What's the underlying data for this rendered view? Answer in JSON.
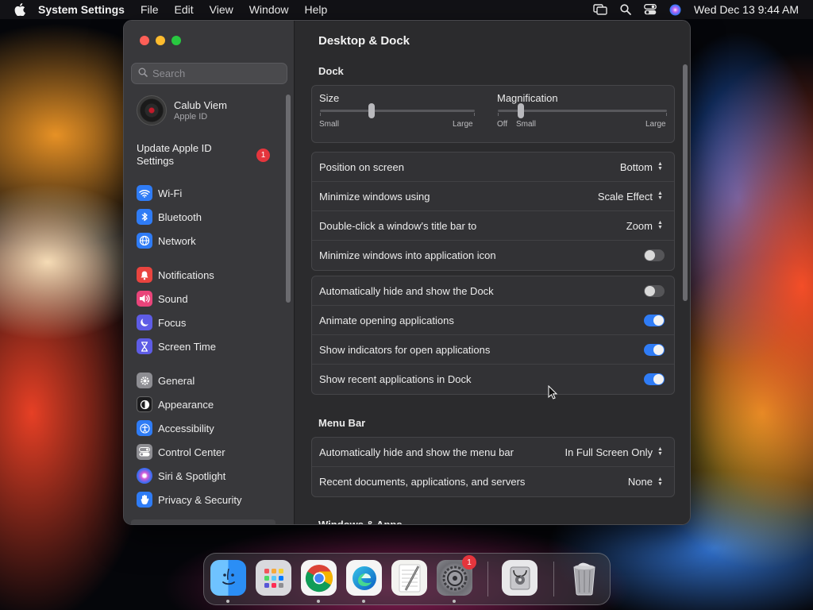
{
  "menubar": {
    "app_name": "System Settings",
    "menus": [
      "File",
      "Edit",
      "View",
      "Window",
      "Help"
    ],
    "clock": "Wed Dec 13  9:44 AM"
  },
  "sidebar": {
    "search_placeholder": "Search",
    "account": {
      "name": "Calub Viem",
      "subtitle": "Apple ID"
    },
    "update": {
      "label": "Update Apple ID Settings",
      "badge": "1"
    },
    "groups": [
      [
        {
          "label": "Wi-Fi",
          "icon": "wifi-icon",
          "color": "#2f7cf6"
        },
        {
          "label": "Bluetooth",
          "icon": "bluetooth-icon",
          "color": "#2f7cf6"
        },
        {
          "label": "Network",
          "icon": "globe-icon",
          "color": "#2f7cf6"
        }
      ],
      [
        {
          "label": "Notifications",
          "icon": "bell-icon",
          "color": "#e9443f"
        },
        {
          "label": "Sound",
          "icon": "speaker-icon",
          "color": "#e9447a"
        },
        {
          "label": "Focus",
          "icon": "moon-icon",
          "color": "#5e5ce6"
        },
        {
          "label": "Screen Time",
          "icon": "hourglass-icon",
          "color": "#5e5ce6"
        }
      ],
      [
        {
          "label": "General",
          "icon": "gear-icon",
          "color": "#8e8e93"
        },
        {
          "label": "Appearance",
          "icon": "appearance-icon",
          "color": "#1c1c1e"
        },
        {
          "label": "Accessibility",
          "icon": "accessibility-icon",
          "color": "#2f7cf6"
        },
        {
          "label": "Control Center",
          "icon": "control-center-icon",
          "color": "#8e8e93"
        },
        {
          "label": "Siri & Spotlight",
          "icon": "siri-icon",
          "color": "#b04bd8"
        },
        {
          "label": "Privacy & Security",
          "icon": "hand-icon",
          "color": "#2f7cf6"
        }
      ]
    ]
  },
  "main": {
    "title": "Desktop & Dock",
    "dock_section": "Dock",
    "size_slider": {
      "label": "Size",
      "min_label": "Small",
      "max_label": "Large",
      "value": 0.33
    },
    "magnification_slider": {
      "label": "Magnification",
      "off_label": "Off",
      "min_label": "Small",
      "max_label": "Large",
      "value": 0.14
    },
    "dock_settings": [
      {
        "label": "Position on screen",
        "value": "Bottom"
      },
      {
        "label": "Minimize windows using",
        "value": "Scale Effect"
      },
      {
        "label": "Double-click a window's title bar to",
        "value": "Zoom"
      },
      {
        "label": "Minimize windows into application icon",
        "toggle": false
      }
    ],
    "dock_toggles": [
      {
        "label": "Automatically hide and show the Dock",
        "toggle": false
      },
      {
        "label": "Animate opening applications",
        "toggle": true
      },
      {
        "label": "Show indicators for open applications",
        "toggle": true
      },
      {
        "label": "Show recent applications in Dock",
        "toggle": true
      }
    ],
    "menubar_section": "Menu Bar",
    "menubar_settings": [
      {
        "label": "Automatically hide and show the menu bar",
        "value": "In Full Screen Only"
      },
      {
        "label": "Recent documents, applications, and servers",
        "value": "None"
      }
    ],
    "next_section": "Windows & Apps"
  },
  "dock": {
    "apps": [
      "finder-icon",
      "launchpad-icon",
      "chrome-icon",
      "edge-icon",
      "textedit-icon",
      "system-settings-icon",
      "disk-utility-icon",
      "trash-icon"
    ],
    "settings_badge": "1"
  },
  "colors": {
    "accent": "#2f7cf6",
    "badge": "#e5353d"
  }
}
